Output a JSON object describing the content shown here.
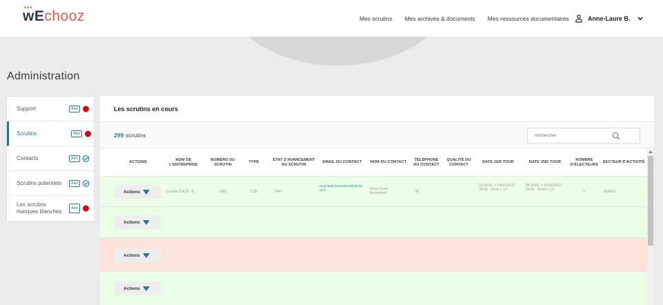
{
  "app": {
    "logo_part1": "wE",
    "logo_part2": "chooz"
  },
  "nav": {
    "links": [
      "Mes scrutins",
      "Mes archives & documents",
      "Mes ressources documentaires"
    ],
    "user_name": "Anne-Laure B."
  },
  "page": {
    "title": "Administration"
  },
  "sidebar": {
    "items": [
      {
        "label": "Support",
        "badge": "Adm",
        "status": "red"
      },
      {
        "label": "Scrutins",
        "badge": "Adm",
        "status": "red",
        "active": true
      },
      {
        "label": "Contacts",
        "badge": "Adm",
        "status": "check"
      },
      {
        "label": "Scrutins potentiels",
        "badge": "Adm",
        "status": "check"
      },
      {
        "label": "Les scrutins marques blanches",
        "badge": "Adm",
        "status": "red"
      }
    ]
  },
  "panel": {
    "title": "Les scrutins en cours",
    "count": "299",
    "count_label": "scrutins",
    "search_placeholder": "Rechercher"
  },
  "table": {
    "headers": [
      "ACTIONS",
      "NOM DE L'ENTREPRISE",
      "NUMÉRO DU SCRUTIN",
      "TYPE",
      "ETAT D'AVANCEMENT DU SCRUTIN",
      "EMAIL DU CONTACT",
      "NOM DU CONTACT",
      "TÉLÉPHONE DU CONTACT",
      "QUALITÉ DU CONTACT",
      "DATE 1ER TOUR",
      "DATE 2ND TOUR",
      "NOMBRE D'ÉLECTEURS",
      "SECTEUR D'ACTIVITÉ"
    ],
    "action_label": "Actions",
    "rows": [
      {
        "color": "green",
        "company": "Societe B ALB - B",
        "number": "1985",
        "type": "CSE",
        "state": "PAP",
        "email": "anne-laure.bonnefond@wechooz.fr",
        "contact": "Anne-Laure Bonnefond",
        "phone": "06",
        "quality": "",
        "date1": "25 09:00 -> 24/01/2022 09:00 - 18:00 + 15'",
        "date2": "06 09:00 -> 07/02/2022 09:00 - 18:00 + 15'",
        "voters": "0",
        "sector": "AGROZ"
      },
      {
        "color": "green"
      },
      {
        "color": "red"
      },
      {
        "color": "green"
      }
    ]
  },
  "colors": {
    "accent": "#1b7a8c",
    "logo_red": "#e2574c",
    "status_red": "#e3000b",
    "row_green": "#eaffe5",
    "row_red": "#fce3d9"
  }
}
